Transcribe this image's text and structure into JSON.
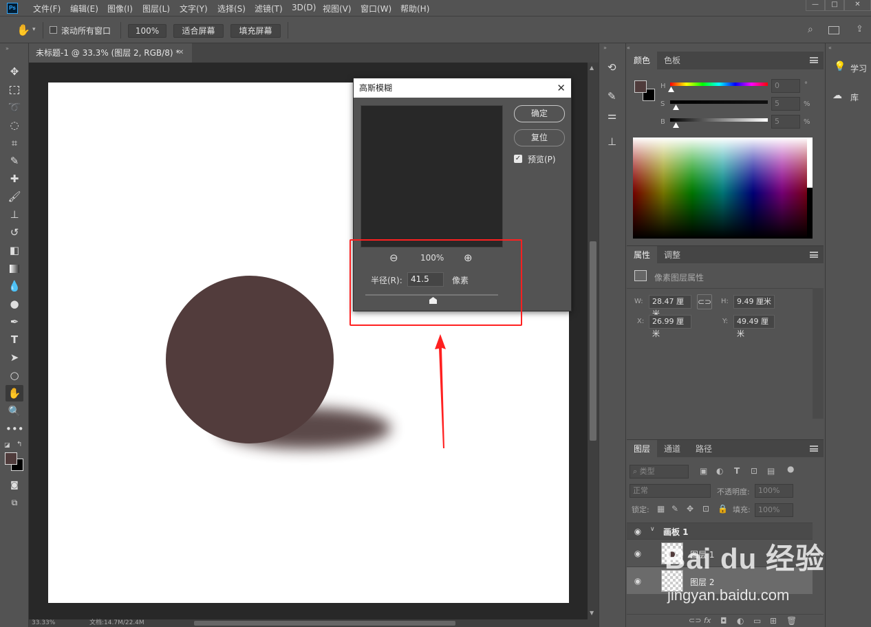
{
  "app": {
    "logo": "Ps"
  },
  "menu": [
    "文件(F)",
    "编辑(E)",
    "图像(I)",
    "图层(L)",
    "文字(Y)",
    "选择(S)",
    "滤镜(T)",
    "3D(D)",
    "视图(V)",
    "窗口(W)",
    "帮助(H)"
  ],
  "options": {
    "scroll_all_label": "滚动所有窗口",
    "zoom_value": "100%",
    "fit_screen": "适合屏幕",
    "fill_screen": "填充屏幕"
  },
  "document": {
    "tab_title": "未标题-1 @ 33.3% (图层 2, RGB/8) *",
    "zoom_status": "33.33%",
    "doc_status": "文档:14.7M/22.4M"
  },
  "dialog": {
    "title": "高斯模糊",
    "ok": "确定",
    "reset": "复位",
    "preview_label": "预览(P)",
    "preview_checked": true,
    "zoom_percent": "100%",
    "radius_label": "半径(R):",
    "radius_value": "41.5",
    "radius_unit": "像素"
  },
  "color_panel": {
    "tabs": [
      "颜色",
      "色板"
    ],
    "h_label": "H",
    "s_label": "S",
    "b_label": "B",
    "h_value": "0",
    "s_value": "5",
    "b_value": "5",
    "h_unit": "°",
    "s_unit": "%",
    "b_unit": "%",
    "foreground": "#4f3b3b",
    "background": "#000000"
  },
  "properties_panel": {
    "tabs": [
      "属性",
      "调整"
    ],
    "subtitle": "像素图层属性",
    "w_label": "W:",
    "w_value": "28.47 厘米",
    "h_label": "H:",
    "h_value": "9.49 厘米",
    "x_label": "X:",
    "x_value": "26.99 厘米",
    "y_label": "Y:",
    "y_value": "49.49 厘米"
  },
  "layers_panel": {
    "tabs": [
      "图层",
      "通道",
      "路径"
    ],
    "filter_kind": "类型",
    "blend_mode": "正常",
    "opacity_label": "不透明度:",
    "opacity_value": "100%",
    "lock_label": "锁定:",
    "fill_label": "填充:",
    "fill_value": "100%",
    "layers": [
      {
        "name": "画板 1",
        "type": "artboard"
      },
      {
        "name": "图层 1",
        "type": "layer"
      },
      {
        "name": "图层 2",
        "type": "layer"
      }
    ]
  },
  "right_dock": {
    "learn": "学习",
    "library": "库"
  },
  "watermark": {
    "brand": "Bai du 经验",
    "url": "jingyan.baidu.com"
  },
  "colors": {
    "circle": "#523c3c",
    "highlight": "#ff2020"
  }
}
